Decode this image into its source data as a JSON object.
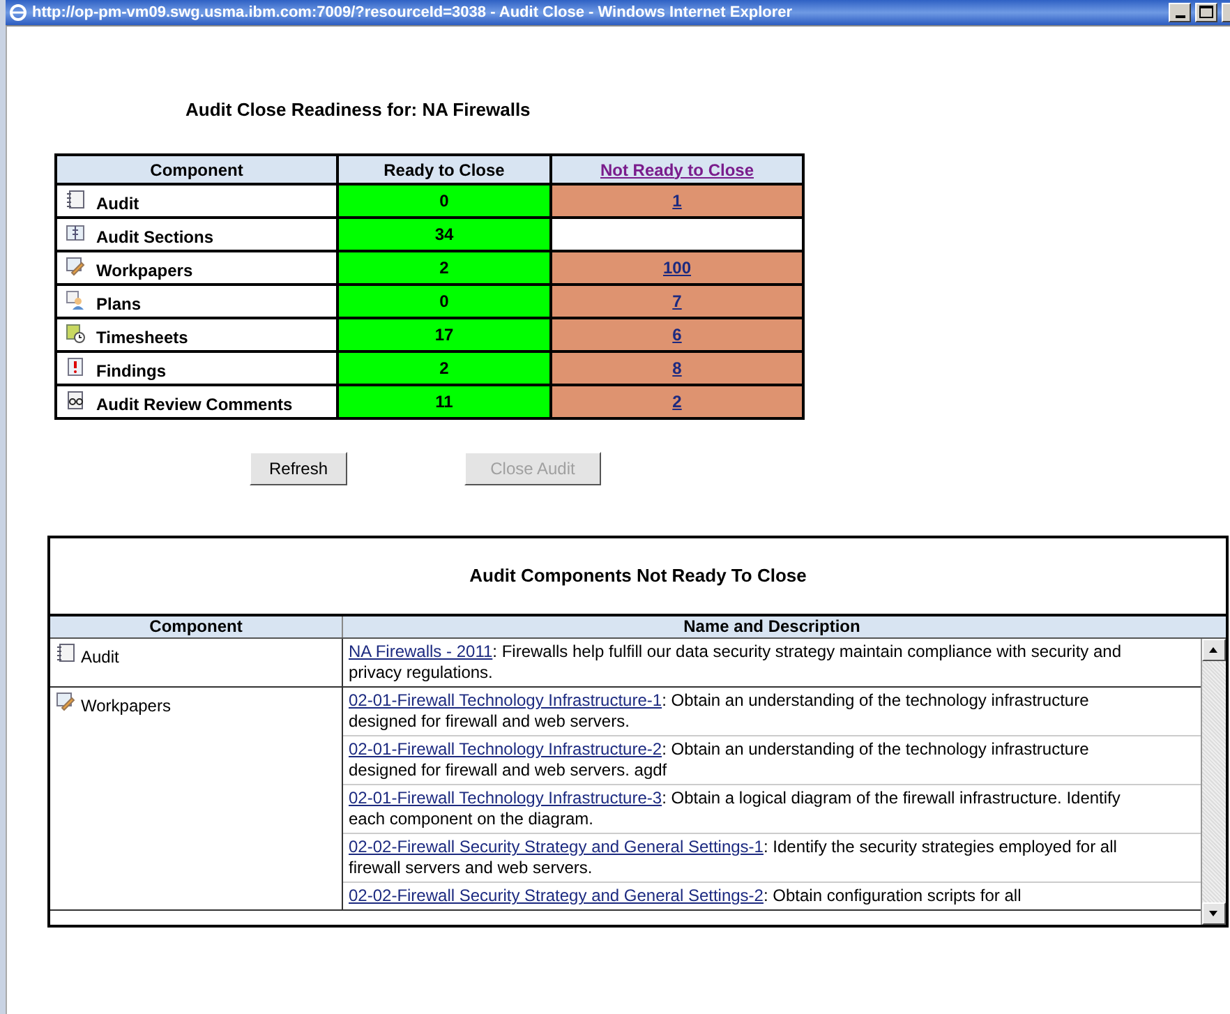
{
  "window": {
    "title": "http://op-pm-vm09.swg.usma.ibm.com:7009/?resourceId=3038 - Audit Close - Windows Internet Explorer"
  },
  "heading": "Audit Close Readiness for:  NA Firewalls",
  "summary": {
    "columns": [
      "Component",
      "Ready to Close",
      "Not Ready to Close"
    ],
    "rows": [
      {
        "kind": "audit",
        "component": "Audit",
        "ready": "0",
        "not_ready": "1"
      },
      {
        "kind": "sections",
        "component": "Audit Sections",
        "ready": "34"
      },
      {
        "kind": "workpapers",
        "component": "Workpapers",
        "ready": "2",
        "not_ready": "100"
      },
      {
        "kind": "plans",
        "component": "Plans",
        "ready": "0",
        "not_ready": "7"
      },
      {
        "kind": "timesheets",
        "component": "Timesheets",
        "ready": "17",
        "not_ready": "6"
      },
      {
        "kind": "findings",
        "component": "Findings",
        "ready": "2",
        "not_ready": "8"
      },
      {
        "kind": "comments",
        "component": "Audit Review Comments",
        "ready": "11",
        "not_ready": "2"
      }
    ]
  },
  "buttons": [
    {
      "label": "Refresh",
      "disabled": false
    },
    {
      "label": "Close Audit",
      "disabled": true
    }
  ],
  "details": {
    "title": "Audit Components Not Ready To Close",
    "columns": [
      "Component",
      "Name and Description"
    ],
    "rows": [
      {
        "kind": "audit",
        "component": "Audit",
        "items": [
          {
            "link": "NA Firewalls - 2011",
            "text": ": Firewalls help fulfill our data security strategy maintain compliance with security and privacy regulations."
          }
        ]
      },
      {
        "kind": "workpapers",
        "component": "Workpapers",
        "items": [
          {
            "link": "02-01-Firewall Technology Infrastructure-1",
            "text": ": Obtain an understanding of the technology infrastructure designed for firewall and web servers."
          },
          {
            "link": "02-01-Firewall Technology Infrastructure-2",
            "text": ": Obtain an understanding of the technology infrastructure designed for firewall and web servers. agdf"
          },
          {
            "link": "02-01-Firewall Technology Infrastructure-3",
            "text": ": Obtain a logical diagram of the firewall infrastructure. Identify each component on the diagram."
          },
          {
            "link": "02-02-Firewall Security Strategy and General Settings-1",
            "text": ": Identify the security strategies employed for all firewall servers and web servers."
          },
          {
            "link": "02-02-Firewall Security Strategy and General Settings-2",
            "text": ": Obtain configuration scripts for all"
          }
        ]
      }
    ]
  }
}
